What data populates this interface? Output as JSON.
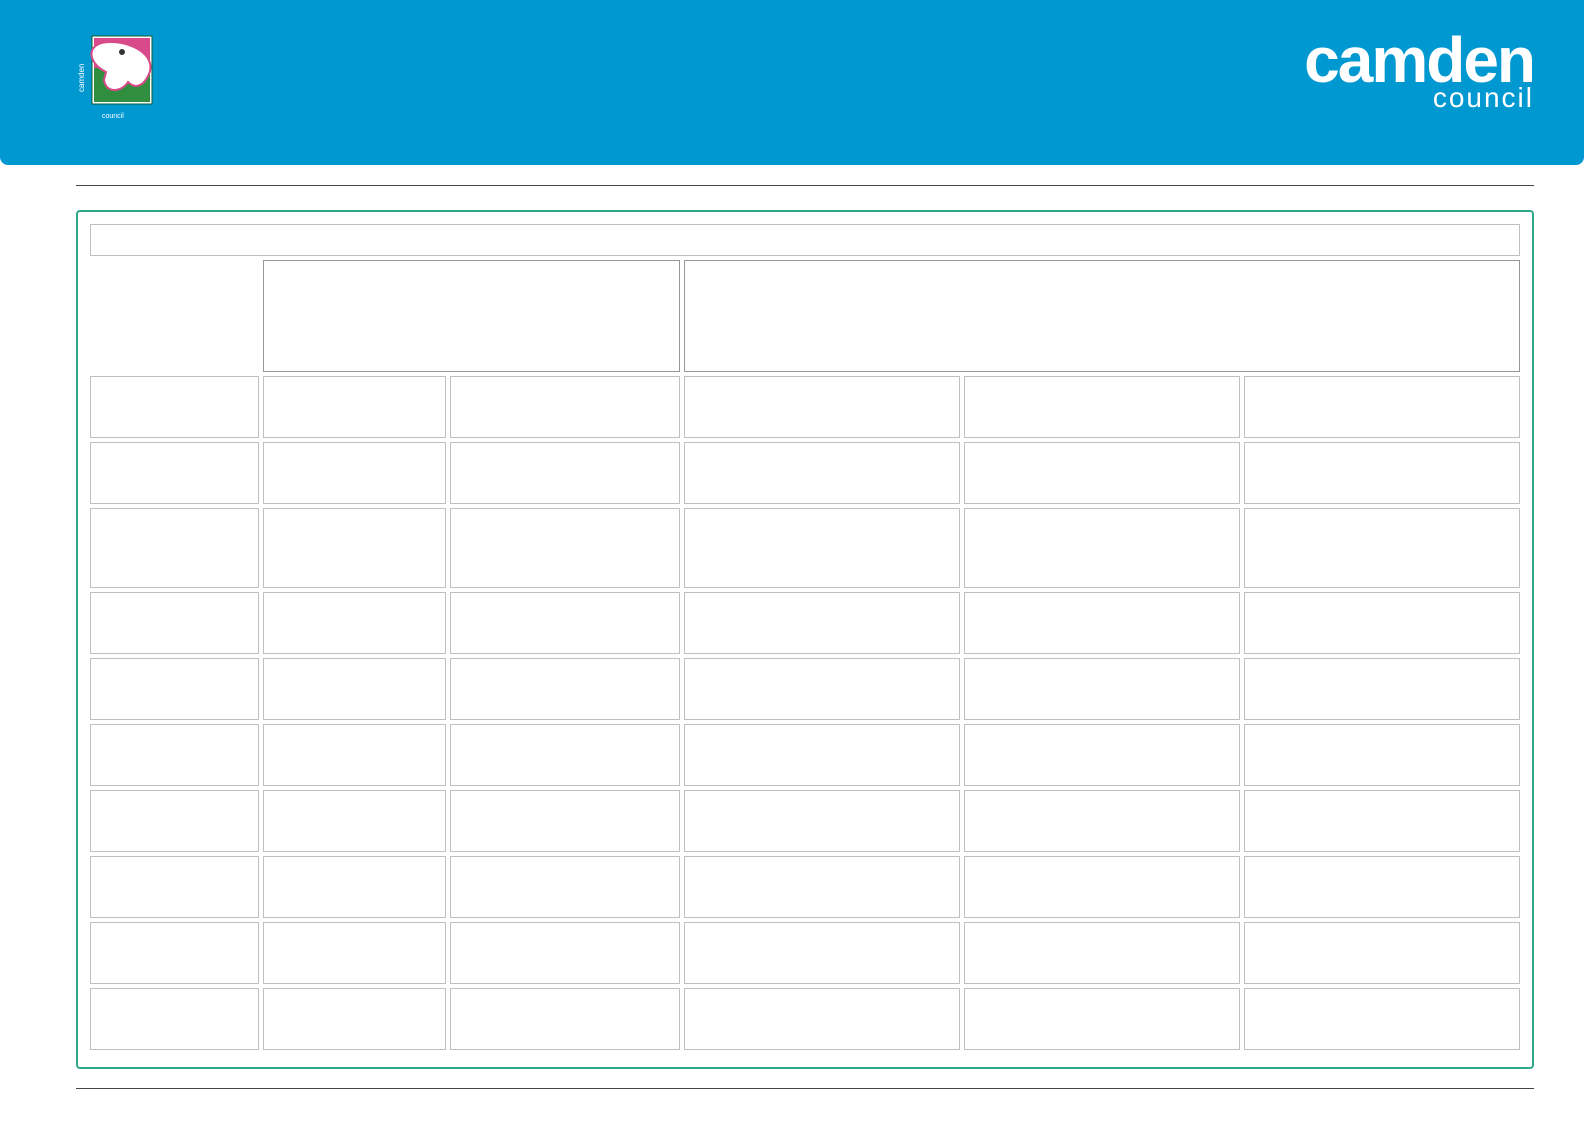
{
  "brand": {
    "name": "camden",
    "sub": "council"
  },
  "table": {
    "mergedTop": "",
    "header": {
      "h1": "",
      "h2": ""
    },
    "rows": [
      {
        "label": "",
        "c1": "",
        "c2": "",
        "c3": "",
        "c4": "",
        "c5": ""
      },
      {
        "label": "",
        "c1": "",
        "c2": "",
        "c3": "",
        "c4": "",
        "c5": ""
      },
      {
        "label": "",
        "c1": "",
        "c2": "",
        "c3": "",
        "c4": "",
        "c5": ""
      },
      {
        "label": "",
        "c1": "",
        "c2": "",
        "c3": "",
        "c4": "",
        "c5": ""
      },
      {
        "label": "",
        "c1": "",
        "c2": "",
        "c3": "",
        "c4": "",
        "c5": ""
      },
      {
        "label": "",
        "c1": "",
        "c2": "",
        "c3": "",
        "c4": "",
        "c5": ""
      },
      {
        "label": "",
        "c1": "",
        "c2": "",
        "c3": "",
        "c4": "",
        "c5": ""
      },
      {
        "label": "",
        "c1": "",
        "c2": "",
        "c3": "",
        "c4": "",
        "c5": ""
      },
      {
        "label": "",
        "c1": "",
        "c2": "",
        "c3": "",
        "c4": "",
        "c5": ""
      },
      {
        "label": "",
        "c1": "",
        "c2": "",
        "c3": "",
        "c4": "",
        "c5": ""
      }
    ]
  }
}
